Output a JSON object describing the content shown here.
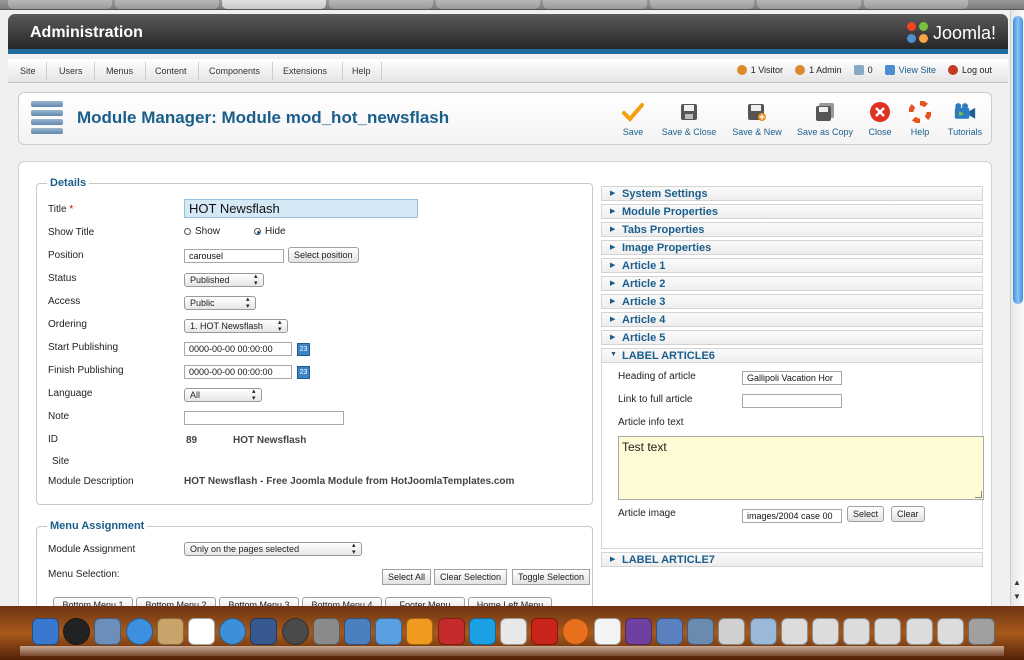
{
  "header": {
    "title": "Administration",
    "logo_text": "Joomla!"
  },
  "menu": {
    "items": [
      "Site",
      "Users",
      "Menus",
      "Content",
      "Components",
      "Extensions",
      "Help"
    ]
  },
  "status": {
    "visitors": "1 Visitor",
    "admins": "1 Admin",
    "messages": "0",
    "view_site": "View Site",
    "logout": "Log out"
  },
  "toolbar": {
    "page_title": "Module Manager: Module mod_hot_newsflash",
    "buttons": [
      {
        "label": "Save",
        "icon": "checkmark-icon"
      },
      {
        "label": "Save & Close",
        "icon": "floppy-icon"
      },
      {
        "label": "Save & New",
        "icon": "floppy-plus-icon"
      },
      {
        "label": "Save as Copy",
        "icon": "floppy-copy-icon"
      },
      {
        "label": "Close",
        "icon": "close-icon"
      },
      {
        "label": "Help",
        "icon": "lifebuoy-icon"
      },
      {
        "label": "Tutorials",
        "icon": "video-camera-icon"
      }
    ]
  },
  "details": {
    "legend": "Details",
    "title_label": "Title",
    "required_mark": "*",
    "title_value": "HOT Newsflash",
    "show_title_label": "Show Title",
    "show_title_options": [
      "Show",
      "Hide"
    ],
    "show_title_selected": "Hide",
    "position_label": "Position",
    "position_value": "carousel",
    "select_position_button": "Select position",
    "status_label": "Status",
    "status_value": "Published",
    "access_label": "Access",
    "access_value": "Public",
    "ordering_label": "Ordering",
    "ordering_value": "1. HOT Newsflash",
    "start_publishing_label": "Start Publishing",
    "start_publishing_value": "0000-00-00 00:00:00",
    "finish_publishing_label": "Finish Publishing",
    "finish_publishing_value": "0000-00-00 00:00:00",
    "calendar_icon_text": "23",
    "language_label": "Language",
    "language_value": "All",
    "note_label": "Note",
    "note_value": "",
    "id_label": "ID",
    "id_value": "89",
    "id_name": "HOT Newsflash",
    "site_label": "Site",
    "module_description_label": "Module Description",
    "module_description_value": "HOT Newsflash - Free Joomla Module from HotJoomlaTemplates.com"
  },
  "menu_assignment": {
    "legend": "Menu Assignment",
    "module_assignment_label": "Module Assignment",
    "module_assignment_value": "Only on the pages selected",
    "menu_selection_label": "Menu Selection:",
    "select_all_button": "Select All",
    "clear_selection_button": "Clear Selection",
    "toggle_selection_button": "Toggle Selection",
    "menu_tabs": [
      "Bottom Menu 1",
      "Bottom Menu 2",
      "Bottom Menu 3",
      "Bottom Menu 4",
      "Footer Menu",
      "Home Left Menu"
    ]
  },
  "accordion": {
    "panels": [
      "System Settings",
      "Module Properties",
      "Tabs Properties",
      "Image Properties",
      "Article 1",
      "Article 2",
      "Article 3",
      "Article 4",
      "Article 5"
    ],
    "open_panel": "LABEL ARTICLE6",
    "last_panel": "LABEL ARTICLE7",
    "heading_label": "Heading of article",
    "heading_value": "Gallipoli Vacation Hor",
    "link_label": "Link to full article",
    "link_value": "",
    "info_label": "Article info text",
    "info_value": "Test text",
    "image_label": "Article image",
    "image_value": "images/2004 case 00",
    "select_button": "Select",
    "clear_button": "Clear"
  },
  "colors": {
    "brand_blue": "#1a5e8c",
    "header_dark": "#262626",
    "title_input_bg": "#d5e8f6",
    "textarea_bg": "#fffbd4"
  },
  "dock": {
    "icons": [
      "finder-icon",
      "dashboard-icon",
      "preview-icon",
      "safari-icon",
      "address-book-icon",
      "ical-icon",
      "itunes-icon",
      "expose-icon",
      "time-machine-icon",
      "system-preferences-icon",
      "iphoto-icon",
      "mail-icon",
      "flower-app-icon",
      "acrobat-icon",
      "skype-icon",
      "textedit-icon",
      "filezilla-icon",
      "firefox-icon",
      "notes-icon",
      "imovie-icon",
      "photo-app-icon",
      "tools-icon",
      "printer-icon",
      "documents-folder-icon",
      "window-thumb-icon",
      "window-thumb-icon",
      "window-thumb-icon",
      "window-thumb-icon",
      "window-thumb-icon",
      "window-thumb-icon",
      "trash-icon"
    ]
  }
}
